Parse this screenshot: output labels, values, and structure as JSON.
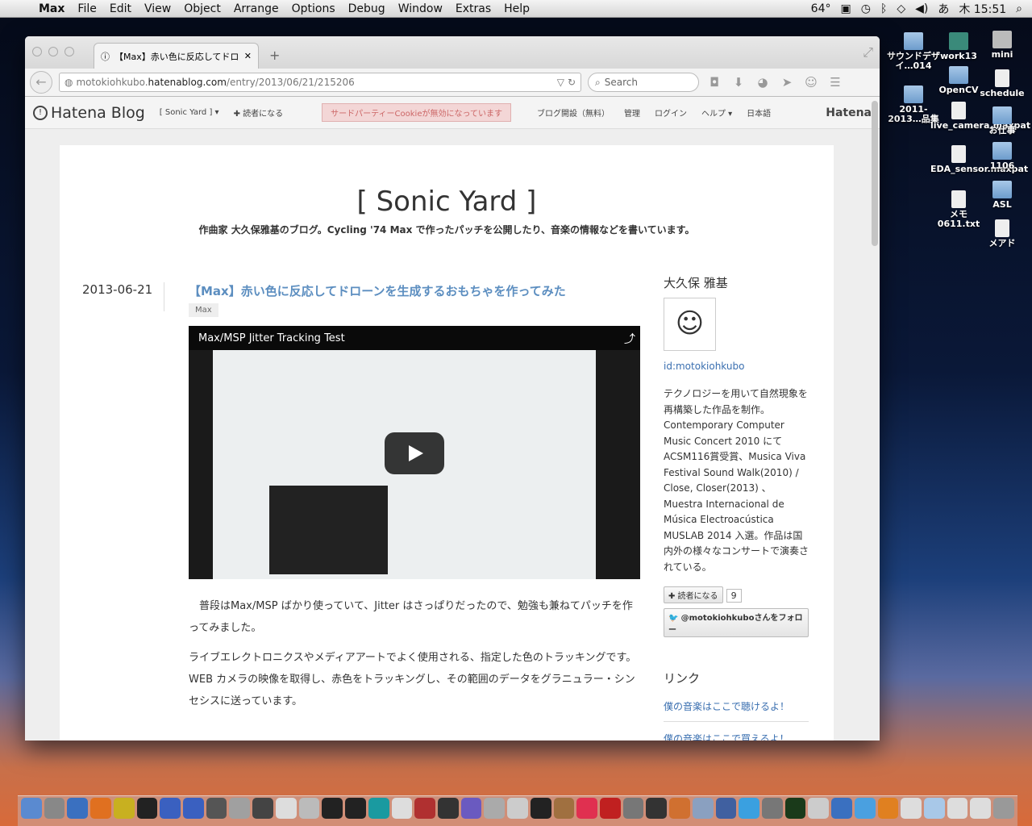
{
  "menubar": {
    "app": "Max",
    "items": [
      "File",
      "Edit",
      "View",
      "Object",
      "Arrange",
      "Options",
      "Debug",
      "Window",
      "Extras",
      "Help"
    ],
    "temp": "64°",
    "clock": "木 15:51",
    "ime": "あ"
  },
  "desktop": [
    {
      "label": "サウンドデザイ…014",
      "type": "folder"
    },
    {
      "label": "work13",
      "type": "drive"
    },
    {
      "label": "mini",
      "type": "hd"
    },
    {
      "label": "OpenCV",
      "type": "folder"
    },
    {
      "label": "schedule",
      "type": "file"
    },
    {
      "label": "2011-2013…品集",
      "type": "folder"
    },
    {
      "label": "live_camera.maxpat",
      "type": "file"
    },
    {
      "label": "お仕事",
      "type": "folder"
    },
    {
      "label": "EDA_sensor.maxpat",
      "type": "file"
    },
    {
      "label": "1106",
      "type": "folder"
    },
    {
      "label": "ASL",
      "type": "folder"
    },
    {
      "label": "メモ0611.txt",
      "type": "file"
    },
    {
      "label": "メアド",
      "type": "file"
    }
  ],
  "browser": {
    "tab_title": "【Max】赤い色に反応してドロ…",
    "url_pre": "motokiohkubo.",
    "url_host": "hatenablog.com",
    "url_path": "/entry/2013/06/21/215206",
    "search_placeholder": "Search"
  },
  "hatena": {
    "logo": "Hatena Blog",
    "blog_menu": "[ Sonic Yard ] ▾",
    "subscribe": "✚ 読者になる",
    "cookie_warning": "サードパーティーCookieが無効になっています",
    "links": [
      "ブログ開設（無料）",
      "管理",
      "ログイン",
      "ヘルプ ▾",
      "日本語"
    ],
    "brand": "Hatena"
  },
  "blog": {
    "title": "[ Sonic Yard ]",
    "description": "作曲家 大久保雅基のブログ。Cycling '74 Max で作ったパッチを公開したり、音楽の情報などを書いています。"
  },
  "entry": {
    "date": "2013-06-21",
    "title": "【Max】赤い色に反応してドローンを生成するおもちゃを作ってみた",
    "category": "Max",
    "video_title": "Max/MSP Jitter Tracking Test",
    "paragraphs": [
      "　普段はMax/MSP ばかり使っていて、Jitter はさっぱりだったので、勉強も兼ねてパッチを作ってみました。",
      "ライブエレクトロニクスやメディアアートでよく使用される、指定した色のトラッキングです。WEB カメラの映像を取得し、赤色をトラッキングし、その範囲のデータをグラニュラー・シンセシスに送っています。"
    ]
  },
  "sidebar": {
    "name": "大久保 雅基",
    "id": "id:motokiohkubo",
    "bio": "テクノロジーを用いて自然現象を再構築した作品を制作。Contemporary Computer Music Concert 2010 にて ACSM116賞受賞、Musica Viva Festival Sound Walk(2010) / Close, Closer(2013) 、Muestra Internacional de Música Electroacústica MUSLAB 2014 入選。作品は国内外の様々なコンサートで演奏されている。",
    "subscribe": "✚ 読者になる",
    "count": "9",
    "twitter": "@motokiohkuboさんをフォロー",
    "links_heading": "リンク",
    "links": [
      "僕の音楽はここで聴けるよ！",
      "僕の音楽はここで買えるよ！"
    ]
  }
}
